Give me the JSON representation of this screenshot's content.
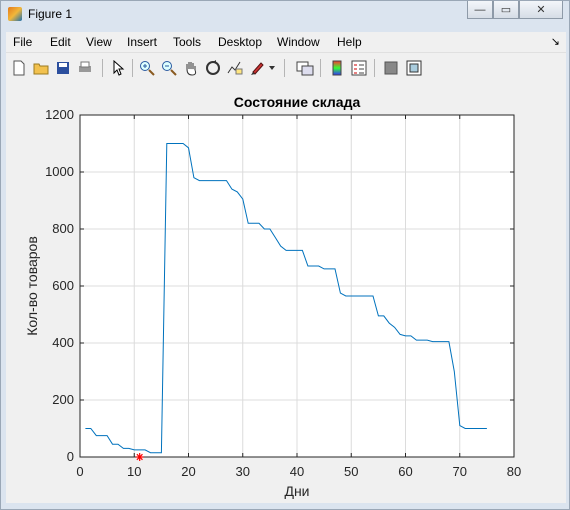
{
  "window": {
    "title": "Figure 1"
  },
  "menu": [
    "File",
    "Edit",
    "View",
    "Insert",
    "Tools",
    "Desktop",
    "Window",
    "Help"
  ],
  "toolbar_icons": [
    "new-figure-icon",
    "open-file-icon",
    "save-icon",
    "print-icon",
    "pointer-icon",
    "zoom-in-icon",
    "zoom-out-icon",
    "pan-icon",
    "rotate-3d-icon",
    "data-cursor-icon",
    "brush-icon",
    "brush-dropdown-icon",
    "link-plot-icon",
    "insert-colorbar-icon",
    "insert-legend-icon",
    "hide-plot-tools-icon",
    "show-plot-tools-icon"
  ],
  "colors": {
    "line": "#0072bd",
    "marker": "#ff0000",
    "axes_bg": "#ffffff",
    "grid": "#dcdcdc"
  },
  "chart_data": {
    "type": "line",
    "title": "Состояние склада",
    "xlabel": "Дни",
    "ylabel": "Кол-во товаров",
    "xlim": [
      0,
      80
    ],
    "ylim": [
      0,
      1200
    ],
    "xticks": [
      0,
      10,
      20,
      30,
      40,
      50,
      60,
      70,
      80
    ],
    "yticks": [
      0,
      200,
      400,
      600,
      800,
      1000,
      1200
    ],
    "grid": true,
    "series": [
      {
        "x": [
          1,
          2,
          3,
          4,
          5,
          6,
          7,
          8,
          9,
          10,
          11,
          12,
          13,
          14,
          15,
          16,
          17,
          18,
          19,
          20,
          21,
          22,
          23,
          24,
          25,
          26,
          27,
          28,
          29,
          30,
          31,
          32,
          33,
          34,
          35,
          36,
          37,
          38,
          39,
          40,
          41,
          42,
          43,
          44,
          45,
          46,
          47,
          48,
          49,
          50,
          51,
          52,
          53,
          54,
          55,
          56,
          57,
          58,
          59,
          60,
          61,
          62,
          63,
          64,
          65,
          66,
          67,
          68,
          69,
          70,
          71,
          72,
          73,
          74,
          75
        ],
        "y": [
          100,
          100,
          75,
          75,
          75,
          45,
          45,
          30,
          30,
          25,
          25,
          25,
          15,
          15,
          15,
          1100,
          1100,
          1100,
          1100,
          1085,
          980,
          970,
          970,
          970,
          970,
          970,
          970,
          940,
          930,
          905,
          820,
          820,
          820,
          800,
          800,
          770,
          740,
          725,
          725,
          725,
          725,
          670,
          670,
          670,
          660,
          660,
          660,
          575,
          565,
          565,
          565,
          565,
          565,
          565,
          495,
          495,
          470,
          455,
          430,
          425,
          425,
          410,
          410,
          410,
          405,
          405,
          405,
          405,
          300,
          110,
          100,
          100,
          100,
          100,
          100
        ]
      }
    ],
    "markers": [
      {
        "x": 11,
        "y": 0,
        "symbol": "*"
      }
    ]
  }
}
